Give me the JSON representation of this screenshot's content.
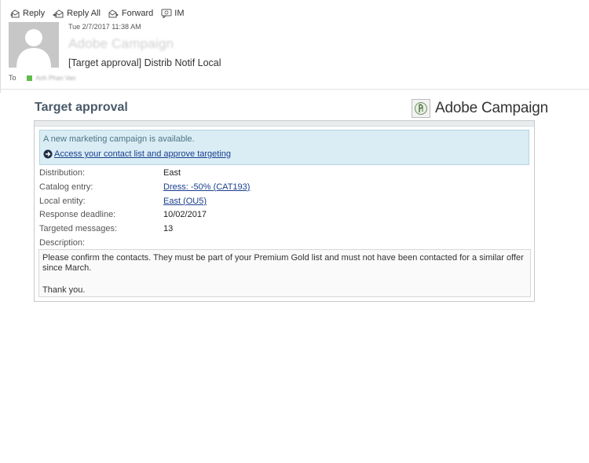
{
  "toolbar": {
    "reply": "Reply",
    "reply_all": "Reply All",
    "forward": "Forward",
    "im": "IM"
  },
  "message": {
    "date": "Tue 2/7/2017 11:38 AM",
    "from": "Adobe Campaign",
    "subject": "[Target approval] Distrib Notif Local",
    "to_label": "To",
    "recipient": "Anh Phan Van"
  },
  "body": {
    "title": "Target approval",
    "brand": "Adobe Campaign",
    "notice": "A new marketing campaign is available.",
    "action_link": "Access your contact list and approve targeting",
    "fields": [
      {
        "label": "Distribution:",
        "value": "East"
      },
      {
        "label": "Catalog entry:",
        "value": "Dress: -50% (CAT193)"
      },
      {
        "label": "Local entity:",
        "value": "East (OU5)"
      },
      {
        "label": "Response deadline:",
        "value": "10/02/2017"
      },
      {
        "label": "Targeted messages:",
        "value": "13"
      },
      {
        "label": "Description:",
        "value": ""
      }
    ],
    "description": "Please confirm the contacts. They must be part of your Premium Gold list and must not have been contacted for a similar offer since March.",
    "closing": "Thank you."
  },
  "icons": [
    "reply-icon",
    "reply-all-icon",
    "forward-icon",
    "im-icon",
    "avatar-silhouette",
    "adobe-campaign-logo-icon",
    "circle-arrow-icon"
  ],
  "colors": {
    "title": "#4a5a6a",
    "notice_bg": "#daedf4",
    "link": "#1a3f8f",
    "presence": "#5fbd4b"
  }
}
